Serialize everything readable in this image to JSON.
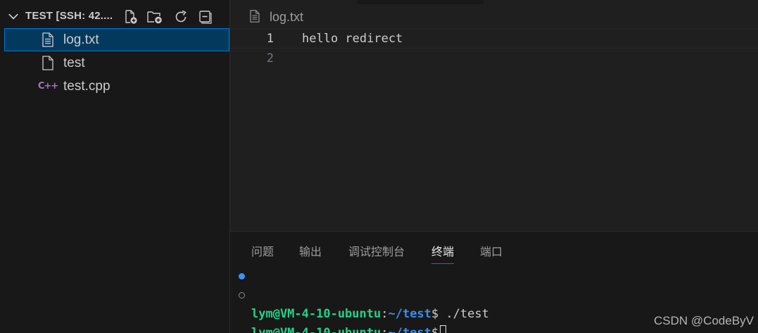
{
  "sidebar": {
    "folder_title": "TEST [SSH: 42....",
    "toolbar": [
      {
        "icon": "new-file-icon"
      },
      {
        "icon": "new-folder-icon"
      },
      {
        "icon": "refresh-icon"
      },
      {
        "icon": "collapse-all-icon"
      }
    ],
    "files": [
      {
        "name": "log.txt",
        "icon": "text-file-icon",
        "selected": true
      },
      {
        "name": "test",
        "icon": "file-icon",
        "selected": false
      },
      {
        "name": "test.cpp",
        "icon": "cpp-file-icon",
        "icon_glyph": "C++",
        "selected": false
      }
    ]
  },
  "editor": {
    "breadcrumb": "log.txt",
    "lines": [
      {
        "number": "1",
        "text": "hello redirect"
      },
      {
        "number": "2",
        "text": ""
      }
    ]
  },
  "panel": {
    "tabs": [
      {
        "label": "问题",
        "active": false
      },
      {
        "label": "输出",
        "active": false
      },
      {
        "label": "调试控制台",
        "active": false
      },
      {
        "label": "终端",
        "active": true
      },
      {
        "label": "端口",
        "active": false
      }
    ],
    "terminal": [
      {
        "user": "lym@VM-4-10-ubuntu",
        "sep": ":",
        "path": "~/test",
        "prompt": "$",
        "command": " ./test",
        "status": "success"
      },
      {
        "user": "lym@VM-4-10-ubuntu",
        "sep": ":",
        "path": "~/test",
        "prompt": "$",
        "command": " ",
        "status": "idle"
      }
    ]
  },
  "watermark": "CSDN @CodeByV",
  "colors": {
    "accent": "#0078d4",
    "selection": "#04395e",
    "term_user": "#23d18b",
    "term_path": "#3b8eea",
    "cpp_icon": "#a074c4"
  }
}
